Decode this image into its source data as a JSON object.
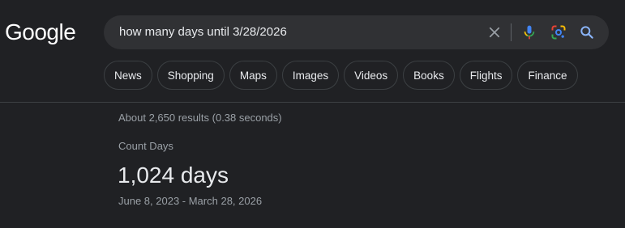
{
  "logo": {
    "text": "Google"
  },
  "search": {
    "value": "how many days until 3/28/2026",
    "icons": [
      "close-icon",
      "mic-icon",
      "lens-icon",
      "search-icon"
    ]
  },
  "chips": [
    {
      "label": "News"
    },
    {
      "label": "Shopping"
    },
    {
      "label": "Maps"
    },
    {
      "label": "Images"
    },
    {
      "label": "Videos"
    },
    {
      "label": "Books"
    },
    {
      "label": "Flights"
    },
    {
      "label": "Finance"
    }
  ],
  "results": {
    "stats": "About 2,650 results (0.38 seconds)"
  },
  "answer_card": {
    "label": "Count Days",
    "value": "1,024 days",
    "range": "June 8, 2023 - March 28, 2026"
  },
  "colors": {
    "background": "#202124",
    "searchbox": "#303134",
    "text": "#e8eaed",
    "muted": "#9aa0a6",
    "border": "#3c4043",
    "accent_blue": "#8ab4f8"
  }
}
